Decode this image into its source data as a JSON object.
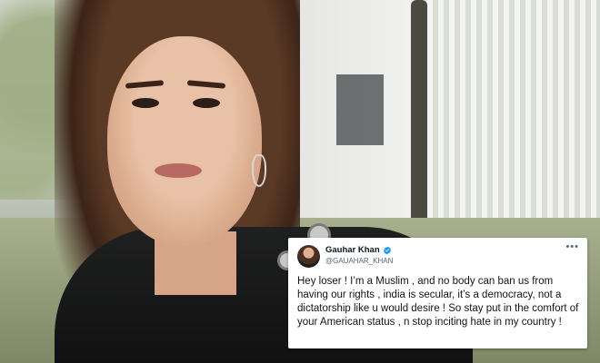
{
  "tweet": {
    "display_name": "Gauhar Khan",
    "handle": "@GAUAHAR_KHAN",
    "more_icon": "more-icon",
    "verified_icon": "verified-badge-icon",
    "verified_color": "#1d9bf0",
    "text": "Hey loser ! I’m a Muslim , and no body can ban us from having our rights , india is secular, it’s a democracy, not a dictatorship like u would desire ! So stay put in the comfort of your American status , n stop inciting hate in my country !"
  }
}
